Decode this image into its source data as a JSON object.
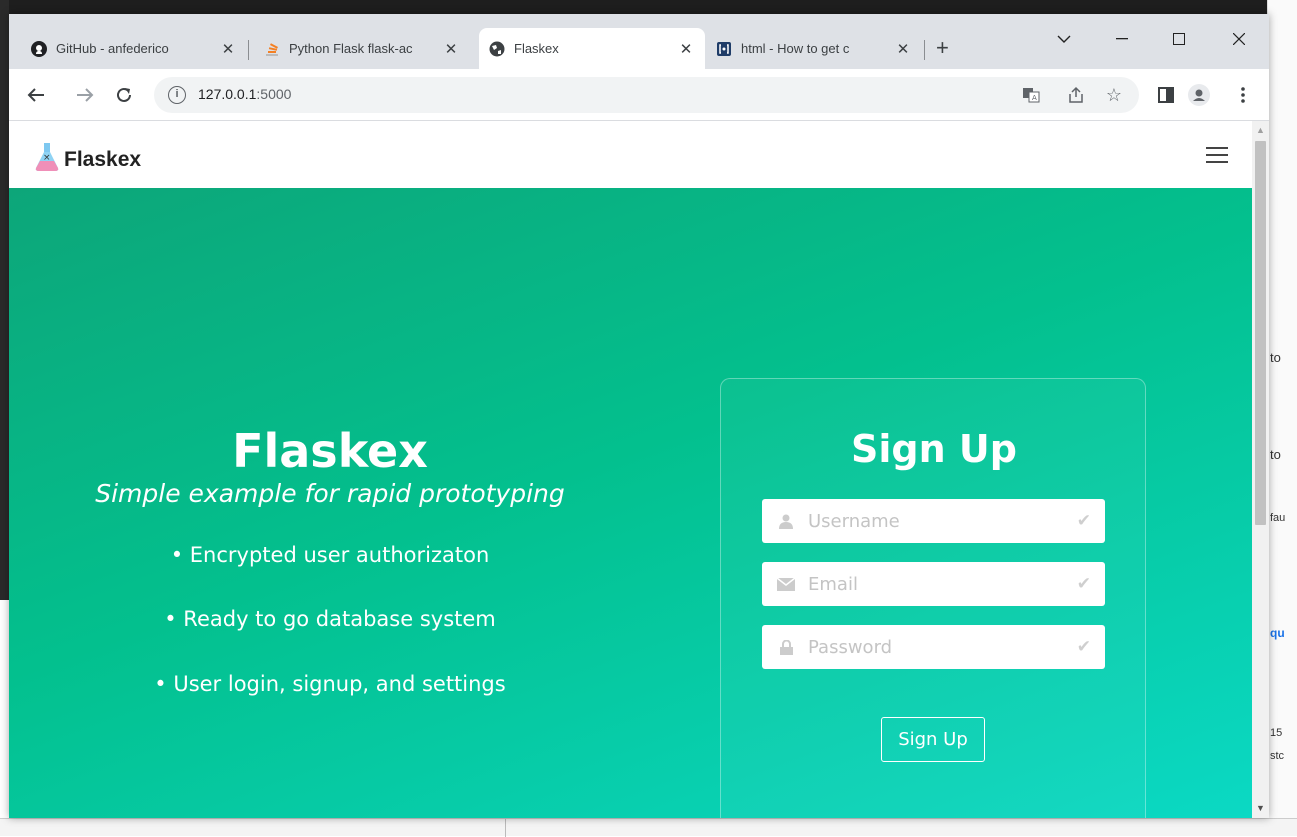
{
  "browser": {
    "tabs": [
      {
        "label": "GitHub - anfederico",
        "favicon": "github-icon"
      },
      {
        "label": "Python Flask flask-ac",
        "favicon": "stackoverflow-icon"
      },
      {
        "label": "Flaskex",
        "favicon": "globe-icon"
      },
      {
        "label": "html - How to get c",
        "favicon": "brackets-icon"
      }
    ],
    "active_tab": 2,
    "new_tab_label": "+",
    "url_host": "127.0.0.1",
    "url_port": ":5000"
  },
  "page": {
    "brand": "Flaskex",
    "hero": {
      "title": "Flaskex",
      "subtitle": "Simple example for rapid prototyping",
      "features": [
        "• Encrypted user authorizaton",
        "• Ready to go database system",
        "• User login, signup, and settings"
      ]
    },
    "signup": {
      "title": "Sign Up",
      "username_placeholder": "Username",
      "email_placeholder": "Email",
      "password_placeholder": "Password",
      "button_label": "Sign Up"
    }
  },
  "desktop": {
    "right_fragments": [
      "to",
      "to",
      "fau",
      "qu",
      "15",
      "stc"
    ]
  },
  "colors": {
    "hero_start": "#0da679",
    "hero_end": "#0bd9c4"
  }
}
